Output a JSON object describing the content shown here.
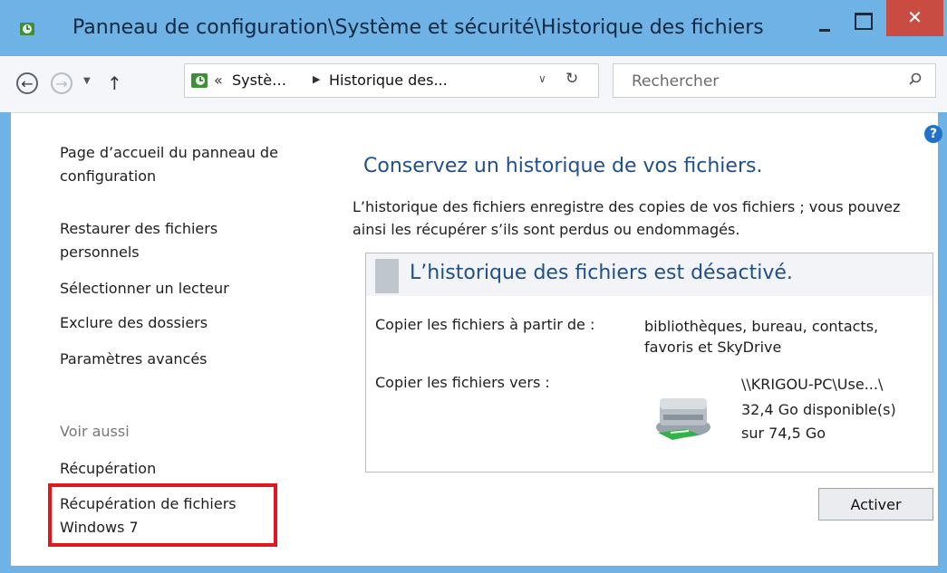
{
  "window": {
    "title": "Panneau de configuration\\Système et sécurité\\Historique des fichiers",
    "close_glyph": "✕"
  },
  "toolbar": {
    "back_glyph": "←",
    "forward_glyph": "→",
    "dropdown_glyph": "▼",
    "up_glyph": "↑",
    "address": {
      "chevrons": "«",
      "crumb1": "Systè…",
      "separator": "▶",
      "crumb2": "Historique des...",
      "dropdown_glyph": "∨",
      "refresh_glyph": "↻"
    },
    "search": {
      "placeholder": "Rechercher",
      "value": ""
    }
  },
  "help_glyph": "?",
  "sidebar": {
    "home_link": "Page d’accueil du panneau de configuration",
    "links": [
      "Restaurer des fichiers personnels",
      "Sélectionner un lecteur",
      "Exclure des dossiers",
      "Paramètres avancés"
    ],
    "see_also": {
      "title": "Voir aussi",
      "links": [
        "Récupération",
        "Récupération de fichiers Windows 7"
      ]
    }
  },
  "main": {
    "title": "Conservez un historique de vos fichiers.",
    "description": "L’historique des fichiers enregistre des copies de vos fichiers ; vous pouvez ainsi les récupérer s’ils sont perdus ou endommagés.",
    "status": "L’historique des fichiers est désactivé.",
    "copy_from_label": "Copier les fichiers à partir de :",
    "copy_from_value": "bibliothèques, bureau, contacts, favoris et SkyDrive",
    "copy_to_label": "Copier les fichiers vers :",
    "drive_path": "\\\\KRIGOU-PC\\Use...\\",
    "drive_free": "32,4 Go disponible(s)",
    "drive_total": "sur 74,5 Go",
    "activate_button": "Activer"
  },
  "colors": {
    "frame": "#6fb2e6",
    "close_button": "#c94c43",
    "heading": "#1f4f89",
    "highlight": "#e0171f",
    "help": "#1f72c8"
  }
}
